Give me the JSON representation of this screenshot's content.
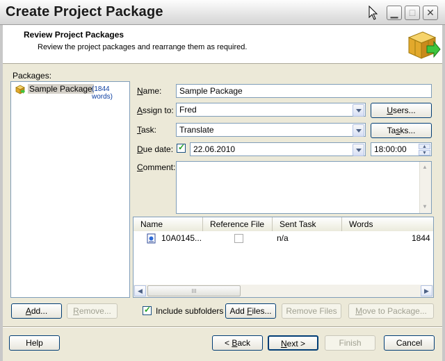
{
  "window": {
    "title": "Create Project Package"
  },
  "header": {
    "title": "Review Project Packages",
    "subtitle": "Review the project packages and  rearrange them as required."
  },
  "packages": {
    "label": "Packages:",
    "items": [
      {
        "name": "Sample Package",
        "words": "(1844 words)"
      }
    ]
  },
  "form": {
    "name_label": "Name:",
    "name_value": "Sample Package",
    "assign_label": "Assign to:",
    "assign_value": "Fred",
    "users_button": "Users...",
    "task_label": "Task:",
    "task_value": "Translate",
    "tasks_button": "Tasks...",
    "due_label": "Due date:",
    "due_date": "22.06.2010",
    "due_time": "18:00:00",
    "comment_label": "Comment:"
  },
  "files_table": {
    "columns": [
      "Name",
      "Reference File",
      "Sent Task",
      "Words"
    ],
    "rows": [
      {
        "name": "10A0145...",
        "reference": false,
        "sent_task": "n/a",
        "words": "1844"
      }
    ],
    "scroll_grip": "III"
  },
  "buttons": {
    "add": "Add...",
    "remove": "Remove...",
    "include_subfolders": "Include subfolders",
    "add_files": "Add Files...",
    "remove_files": "Remove Files",
    "move_to_package": "Move to Package...",
    "help": "Help",
    "back": "< Back",
    "next": "Next >",
    "finish": "Finish",
    "cancel": "Cancel"
  }
}
